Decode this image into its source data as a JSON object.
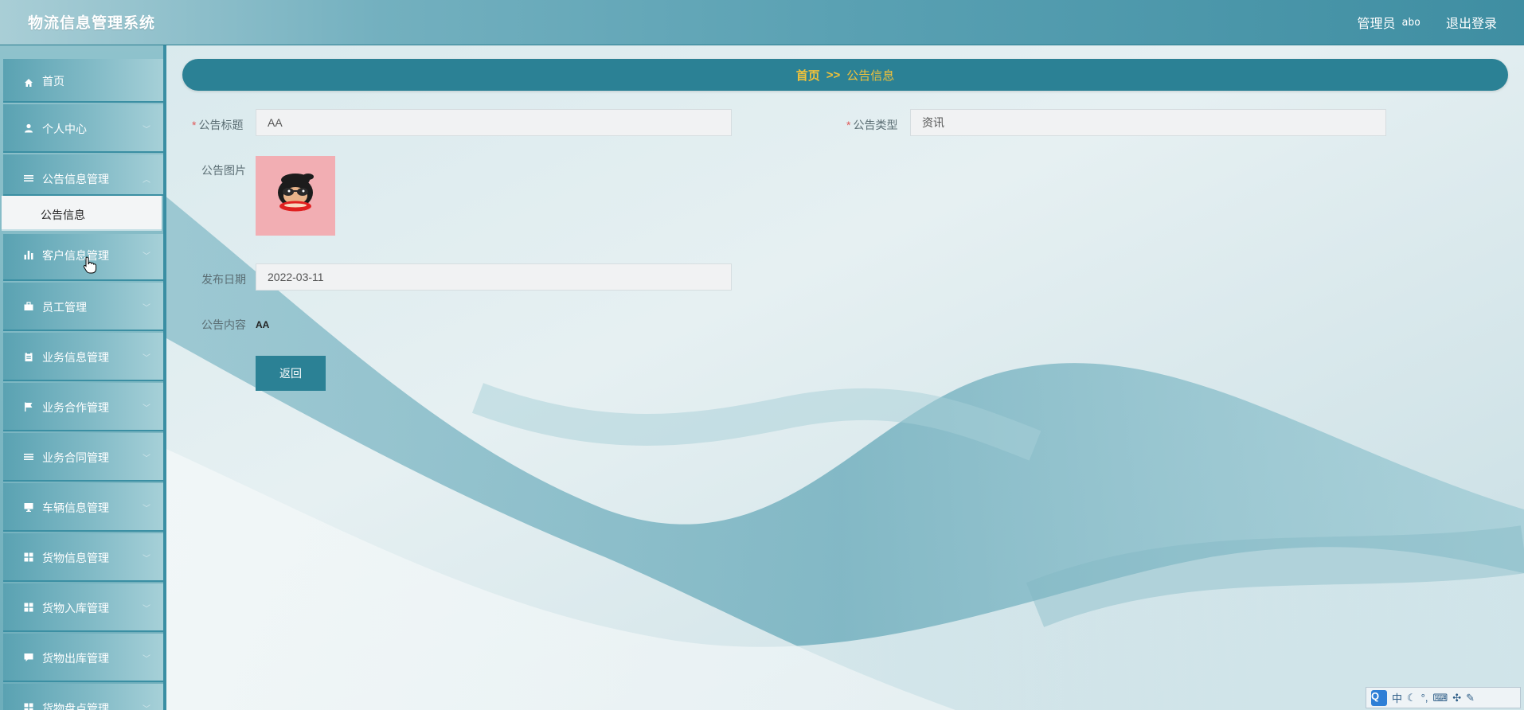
{
  "header": {
    "app_title": "物流信息管理系统",
    "user_role": "管理员",
    "user_name": "abo",
    "logout_label": "退出登录"
  },
  "sidebar": {
    "items": [
      {
        "label": "首页",
        "icon": "home-icon",
        "has_children": false
      },
      {
        "label": "个人中心",
        "icon": "user-icon",
        "has_children": true
      },
      {
        "label": "公告信息管理",
        "icon": "list-icon",
        "has_children": true,
        "expanded": true,
        "children": [
          {
            "label": "公告信息",
            "active": true
          }
        ]
      },
      {
        "label": "客户信息管理",
        "icon": "bar-chart-icon",
        "has_children": true
      },
      {
        "label": "员工管理",
        "icon": "briefcase-icon",
        "has_children": true
      },
      {
        "label": "业务信息管理",
        "icon": "clipboard-icon",
        "has_children": true
      },
      {
        "label": "业务合作管理",
        "icon": "flag-icon",
        "has_children": true
      },
      {
        "label": "业务合同管理",
        "icon": "list-icon",
        "has_children": true
      },
      {
        "label": "车辆信息管理",
        "icon": "monitor-icon",
        "has_children": true
      },
      {
        "label": "货物信息管理",
        "icon": "grid-icon",
        "has_children": true
      },
      {
        "label": "货物入库管理",
        "icon": "grid-icon",
        "has_children": true
      },
      {
        "label": "货物出库管理",
        "icon": "comment-icon",
        "has_children": true
      },
      {
        "label": "货物盘点管理",
        "icon": "grid-icon",
        "has_children": true
      }
    ]
  },
  "breadcrumb": {
    "home": "首页",
    "separator": ">>",
    "current": "公告信息"
  },
  "form": {
    "title_label": "公告标题",
    "title_value": "AA",
    "type_label": "公告类型",
    "type_value": "资讯",
    "image_label": "公告图片",
    "image_icon": "monkey-avatar-image",
    "date_label": "发布日期",
    "date_value": "2022-03-11",
    "content_label": "公告内容",
    "content_value": "AA",
    "back_label": "返回"
  },
  "ime_toolbar": {
    "logo": "Q",
    "mode": "中"
  },
  "colors": {
    "accent": "#2b8195",
    "breadcrumb_text": "#f1c23a",
    "required_marker": "#e05858"
  }
}
